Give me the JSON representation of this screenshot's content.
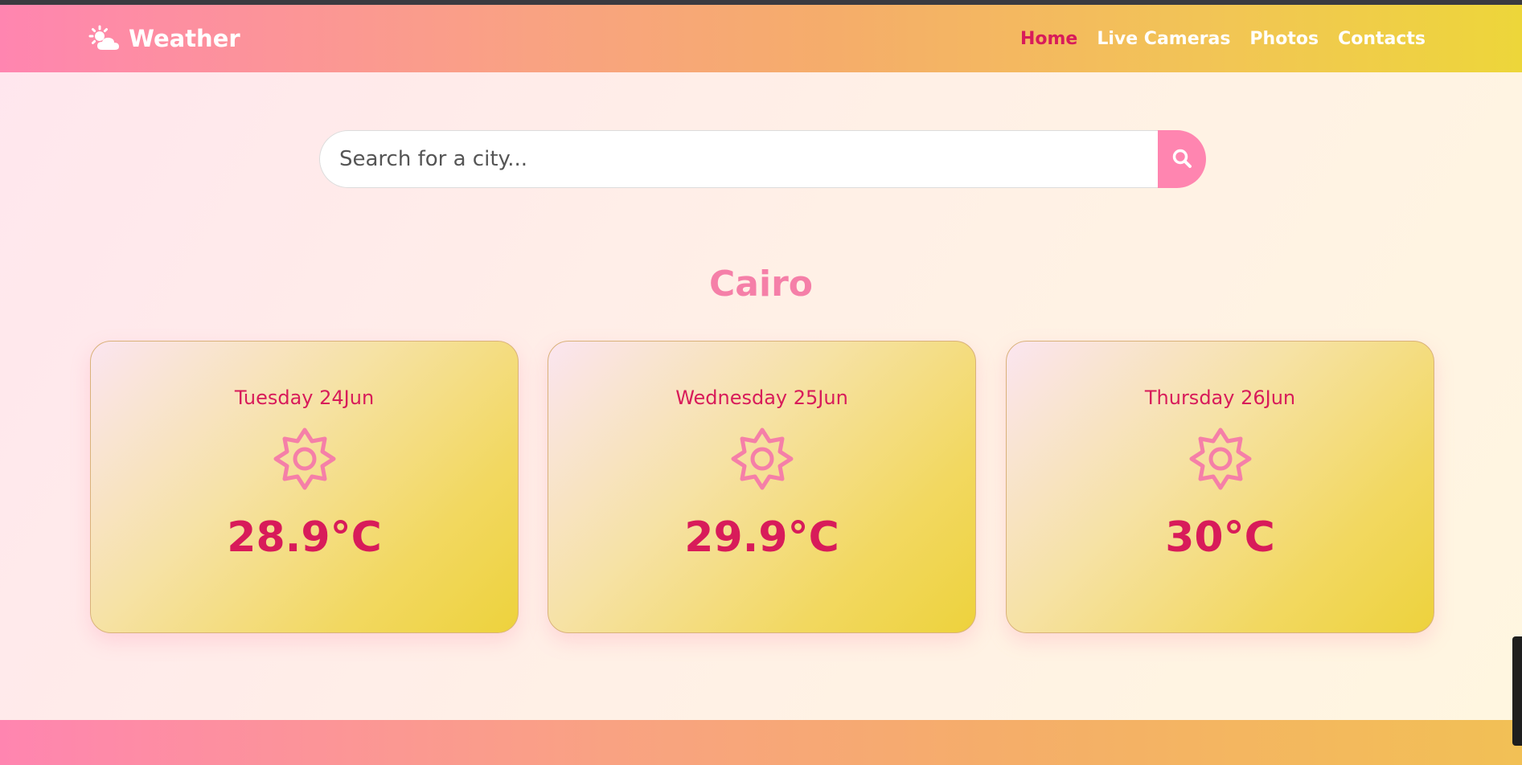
{
  "brand": {
    "name": "Weather",
    "icon": "sun-cloud-icon"
  },
  "nav": {
    "items": [
      {
        "label": "Home",
        "active": true
      },
      {
        "label": "Live Cameras",
        "active": false
      },
      {
        "label": "Photos",
        "active": false
      },
      {
        "label": "Contacts",
        "active": false
      }
    ]
  },
  "search": {
    "placeholder": "Search for a city...",
    "value": "",
    "button_icon": "search-icon"
  },
  "city": "Cairo",
  "forecast": [
    {
      "day": "Tuesday 24Jun",
      "icon": "sun-icon",
      "temp": "28.9°C"
    },
    {
      "day": "Wednesday 25Jun",
      "icon": "sun-icon",
      "temp": "29.9°C"
    },
    {
      "day": "Thursday 26Jun",
      "icon": "sun-icon",
      "temp": "30°C"
    }
  ],
  "colors": {
    "accent": "#d81b5a",
    "pink": "#ff85b0",
    "yellow": "#edd23c"
  }
}
